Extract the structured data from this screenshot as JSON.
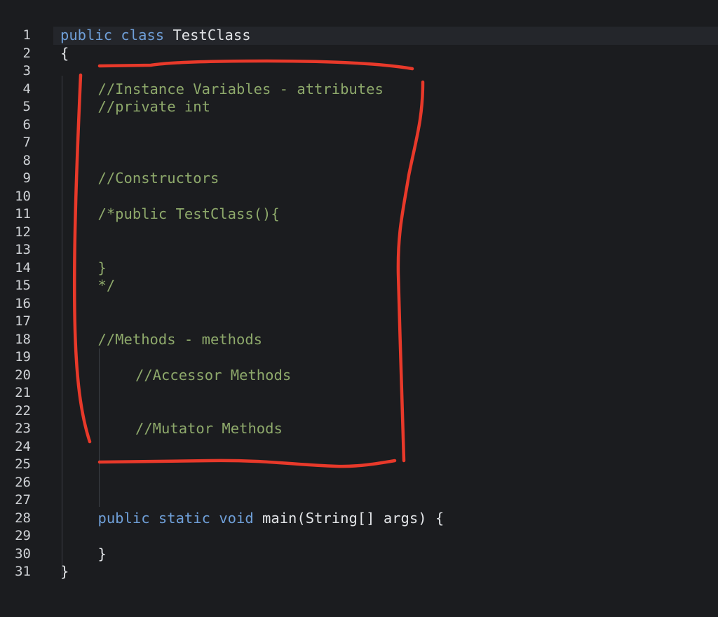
{
  "editor": {
    "line_numbers": [
      "1",
      "2",
      "3",
      "4",
      "5",
      "6",
      "7",
      "8",
      "9",
      "10",
      "11",
      "12",
      "13",
      "14",
      "15",
      "16",
      "17",
      "18",
      "19",
      "20",
      "21",
      "22",
      "23",
      "24",
      "25",
      "26",
      "27",
      "28",
      "29",
      "30",
      "31"
    ],
    "lines": [
      {
        "n": 1,
        "indent": 0,
        "tokens": [
          {
            "t": "kw",
            "v": "public"
          },
          {
            "t": "sp",
            "v": " "
          },
          {
            "t": "kw",
            "v": "class"
          },
          {
            "t": "sp",
            "v": " "
          },
          {
            "t": "id",
            "v": "TestClass"
          }
        ]
      },
      {
        "n": 2,
        "indent": 0,
        "tokens": [
          {
            "t": "id",
            "v": "{"
          }
        ]
      },
      {
        "n": 4,
        "indent": 2,
        "tokens": [
          {
            "t": "cm",
            "v": "//Instance Variables - attributes"
          }
        ]
      },
      {
        "n": 5,
        "indent": 2,
        "tokens": [
          {
            "t": "cm",
            "v": "//private int"
          }
        ]
      },
      {
        "n": 9,
        "indent": 2,
        "tokens": [
          {
            "t": "cm",
            "v": "//Constructors"
          }
        ]
      },
      {
        "n": 11,
        "indent": 2,
        "tokens": [
          {
            "t": "cm",
            "v": "/*public TestClass(){"
          }
        ]
      },
      {
        "n": 14,
        "indent": 2,
        "tokens": [
          {
            "t": "cm",
            "v": "}"
          }
        ]
      },
      {
        "n": 15,
        "indent": 2,
        "tokens": [
          {
            "t": "cm",
            "v": "*/"
          }
        ]
      },
      {
        "n": 18,
        "indent": 2,
        "tokens": [
          {
            "t": "cm",
            "v": "//Methods - methods"
          }
        ]
      },
      {
        "n": 20,
        "indent": 4,
        "tokens": [
          {
            "t": "cm",
            "v": "//Accessor Methods"
          }
        ]
      },
      {
        "n": 23,
        "indent": 4,
        "tokens": [
          {
            "t": "cm",
            "v": "//Mutator Methods"
          }
        ]
      },
      {
        "n": 28,
        "indent": 2,
        "tokens": [
          {
            "t": "kw",
            "v": "public"
          },
          {
            "t": "sp",
            "v": " "
          },
          {
            "t": "kw",
            "v": "static"
          },
          {
            "t": "sp",
            "v": " "
          },
          {
            "t": "kw",
            "v": "void"
          },
          {
            "t": "sp",
            "v": " "
          },
          {
            "t": "id",
            "v": "main(String[] args) {"
          }
        ]
      },
      {
        "n": 30,
        "indent": 2,
        "tokens": [
          {
            "t": "id",
            "v": "}"
          }
        ]
      },
      {
        "n": 31,
        "indent": 0,
        "tokens": [
          {
            "t": "id",
            "v": "}"
          }
        ]
      }
    ],
    "colors": {
      "background": "#1b1c1f",
      "keyword": "#6f9fd8",
      "identifier": "#e2e4e7",
      "comment": "#8ea96b",
      "line_number": "#cfd2d6",
      "annotation": "#e8392a"
    }
  }
}
